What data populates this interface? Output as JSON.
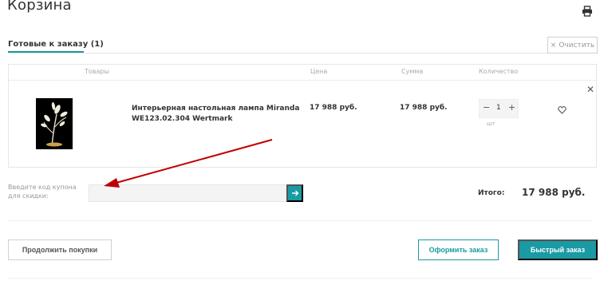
{
  "page": {
    "title": "Корзина"
  },
  "tabs": {
    "ready_label": "Готовые к заказу (1)"
  },
  "toolbar": {
    "clear_label": "Очистить"
  },
  "table": {
    "headers": {
      "products": "Товары",
      "price": "Цена",
      "sum": "Сумма",
      "quantity": "Количество"
    },
    "rows": [
      {
        "name": "Интерьерная настольная лампа Miranda WE123.02.304 Wertmark",
        "price": "17 988 руб.",
        "sum": "17 988 руб.",
        "quantity": "1",
        "unit": "шт",
        "minus": "−",
        "plus": "+"
      }
    ]
  },
  "coupon": {
    "label": "Введите код купона для скидки:",
    "value": ""
  },
  "total": {
    "label": "Итого:",
    "value": "17 988 руб."
  },
  "actions": {
    "continue_label": "Продолжить покупки",
    "checkout_label": "Оформить заказ",
    "quick_label": "Быстрый заказ"
  },
  "colors": {
    "accent": "#1a9aa4",
    "annotation": "#c00000"
  },
  "icons": {
    "print": "print-icon",
    "clear": "close-icon",
    "remove": "close-icon",
    "favorite": "heart-icon",
    "coupon_submit": "arrow-right-icon"
  }
}
